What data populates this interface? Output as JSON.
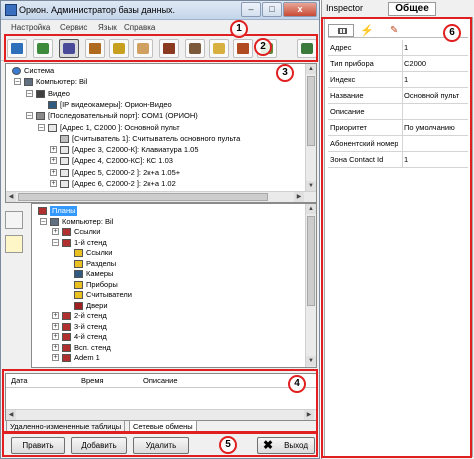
{
  "window": {
    "title": "Орион. Администратор базы данных.",
    "min": "–",
    "max": "□",
    "close": "x"
  },
  "menu": [
    "Настройка",
    "Сервис",
    "Язык",
    "Справка"
  ],
  "toolbar_icons": [
    "db-icon",
    "map-icon",
    "network-icon",
    "tree-icon",
    "document-icon",
    "edit-icon",
    "wheel-icon",
    "printer-icon",
    "folder-icon",
    "users-icon",
    "user-icon",
    "exit-icon"
  ],
  "top_tree": [
    {
      "level": 0,
      "label": "Система",
      "icon": "globe-icon"
    },
    {
      "level": 1,
      "label": "Компьютер: Bil",
      "icon": "computer-icon",
      "expander": "–"
    },
    {
      "level": 2,
      "label": "Видео",
      "icon": "video-icon",
      "expander": "–"
    },
    {
      "level": 3,
      "label": "[IP видеокамеры]: Орион-Видео",
      "icon": "camera-icon"
    },
    {
      "level": 2,
      "label": "[Последовательный порт]: COM1 (ОРИОН)",
      "icon": "port-icon",
      "expander": "–"
    },
    {
      "level": 3,
      "label": "[Адрес 1, С2000 ]: Основной пульт",
      "icon": "device-icon",
      "expander": "–"
    },
    {
      "level": 4,
      "label": "[Считыватель 1]: Считыватель основного пульта",
      "icon": "reader-icon"
    },
    {
      "level": 4,
      "label": "[Адрес 3, С2000-К]: Клавиатура 1.05",
      "icon": "device-icon",
      "expander": "+"
    },
    {
      "level": 4,
      "label": "[Адрес 4, С2000-КС]: КС 1.03",
      "icon": "device-icon",
      "expander": "+"
    },
    {
      "level": 4,
      "label": "[Адрес 5, С2000-2 ]: 2к+а 1.05+",
      "icon": "device-icon",
      "expander": "+"
    },
    {
      "level": 4,
      "label": "[Адрес 6, С2000-2 ]: 2к+а 1.02",
      "icon": "device-icon",
      "expander": "+"
    }
  ],
  "plan_tree": [
    {
      "level": 0,
      "label": "Планы",
      "icon": "plan-icon",
      "selected": true
    },
    {
      "level": 1,
      "label": "Компьютер: Bil",
      "icon": "computer-icon",
      "expander": "–"
    },
    {
      "level": 2,
      "label": "Ссылки",
      "icon": "plan-icon",
      "expander": "+"
    },
    {
      "level": 2,
      "label": "1-й стенд",
      "icon": "plan-icon",
      "expander": "–"
    },
    {
      "level": 3,
      "label": "Ссылки",
      "icon": "folder-icon"
    },
    {
      "level": 3,
      "label": "Разделы",
      "icon": "folder-icon"
    },
    {
      "level": 3,
      "label": "Камеры",
      "icon": "camera-icon"
    },
    {
      "level": 3,
      "label": "Приборы",
      "icon": "folder-icon"
    },
    {
      "level": 3,
      "label": "Считыватели",
      "icon": "folder-icon"
    },
    {
      "level": 3,
      "label": "Двери",
      "icon": "door-icon"
    },
    {
      "level": 2,
      "label": "2-й стенд",
      "icon": "plan-icon",
      "expander": "+"
    },
    {
      "level": 2,
      "label": "3-й стенд",
      "icon": "plan-icon",
      "expander": "+"
    },
    {
      "level": 2,
      "label": "4-й стенд",
      "icon": "plan-icon",
      "expander": "+"
    },
    {
      "level": 2,
      "label": "Всп. стенд",
      "icon": "plan-icon",
      "expander": "+"
    },
    {
      "level": 2,
      "label": "Adem 1",
      "icon": "plan-icon",
      "expander": "+"
    }
  ],
  "log_table": {
    "columns": [
      "Дата",
      "Время",
      "Описание"
    ]
  },
  "bottom_tabs": [
    "Удаленно-измененные таблицы",
    "Сетевые обмены"
  ],
  "buttons": {
    "edit": "Править",
    "add": "Добавить",
    "delete": "Удалить",
    "exit": "Выход"
  },
  "inspector": {
    "title": "Inspector",
    "tab_title": "Общее",
    "properties": [
      {
        "key": "Адрес",
        "value": "1"
      },
      {
        "key": "Тип прибора",
        "value": "С2000"
      },
      {
        "key": "Индекс",
        "value": "1"
      },
      {
        "key": "Название",
        "value": "Основной пульт"
      },
      {
        "key": "Описание",
        "value": ""
      },
      {
        "key": "Приоритет",
        "value": "По умолчанию"
      },
      {
        "key": "Абонентский номер",
        "value": ""
      },
      {
        "key": "Зона Contact Id",
        "value": "1"
      }
    ]
  },
  "callouts": [
    "1",
    "2",
    "3",
    "4",
    "5",
    "6"
  ],
  "colors": {
    "callout": "#e02020",
    "selection": "#3399ff",
    "title_bar": "#c4d5ea"
  }
}
